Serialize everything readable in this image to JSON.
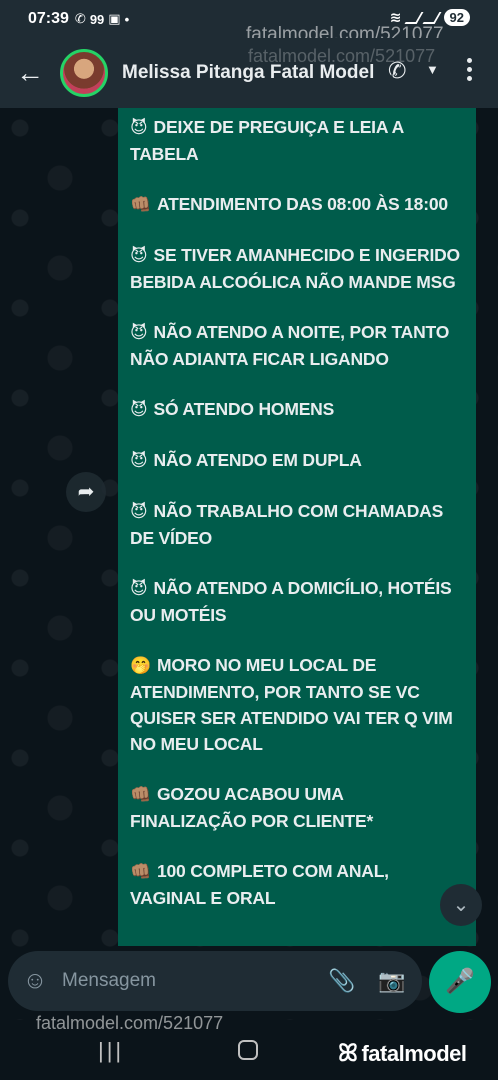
{
  "status_bar": {
    "time": "07:39",
    "icons": [
      "whatsapp-icon",
      "notification-99"
    ],
    "notif_count": "99",
    "battery": "92"
  },
  "header": {
    "contact_name": "Melissa Pitanga Fatal Model"
  },
  "watermarks": {
    "top": "fatalmodel.com/521077",
    "top_faint": "fatalmodel.com/521077",
    "bottom": "fatalmodel.com/521077",
    "logo": "fatalmodel"
  },
  "message": {
    "lines": [
      {
        "emoji": "😈",
        "text": "DEIXE DE PREGUIÇA E LEIA A TABELA"
      },
      {
        "emoji": "👊🏽",
        "text": "ATENDIMENTO DAS 08:00 ÀS 18:00"
      },
      {
        "emoji": "😈",
        "text": "SE TIVER AMANHECIDO  E INGERIDO BEBIDA ALCOÓLICA NÃO MANDE MSG"
      },
      {
        "emoji": "😈",
        "text": "NÃO ATENDO A NOITE, POR TANTO NÃO ADIANTA FICAR LIGANDO"
      },
      {
        "emoji": "😈",
        "text": "SÓ ATENDO HOMENS"
      },
      {
        "emoji": "😈",
        "text": "NÃO ATENDO EM DUPLA"
      },
      {
        "emoji": "😈",
        "text": "NÃO TRABALHO COM CHAMADAS DE VÍDEO"
      },
      {
        "emoji": "😈",
        "text": "NÃO ATENDO A DOMICÍLIO, HOTÉIS OU MOTÉIS"
      },
      {
        "emoji": "🤭",
        "text": "MORO NO MEU LOCAL DE ATENDIMENTO, POR TANTO SE VC QUISER SER ATENDIDO VAI TER Q VIM NO MEU LOCAL"
      },
      {
        "emoji": "👊🏽",
        "text": "GOZOU ACABOU UMA FINALIZAÇÃO POR CLIENTE*"
      },
      {
        "emoji": "👊🏽",
        "text": "100 COMPLETO COM ANAL, VAGINAL E ORAL"
      }
    ]
  },
  "input": {
    "placeholder": "Mensagem"
  },
  "colors": {
    "bubble": "#005c4b",
    "header": "#1f2c34",
    "background": "#0b141a",
    "mic": "#00a884"
  }
}
